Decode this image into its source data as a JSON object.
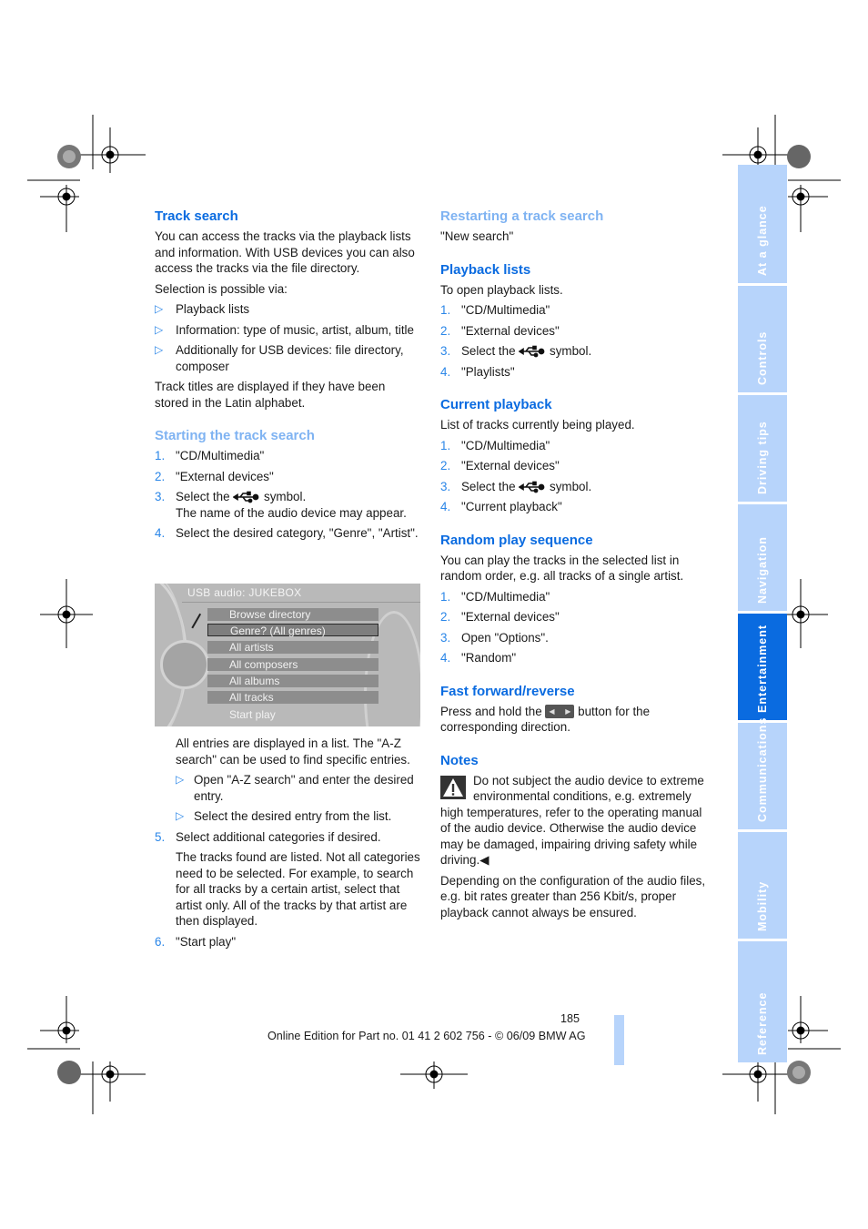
{
  "left": {
    "track_search": {
      "title": "Track search",
      "intro": "You can access the tracks via the playback lists and information. With USB devices you can also access the tracks via the file directory.",
      "selection_label": "Selection is possible via:",
      "bullets": [
        "Playback lists",
        "Information: type of music, artist, album, title",
        "Additionally for USB devices: file directory, composer"
      ],
      "latin_note": "Track titles are displayed if they have been stored in the Latin alphabet."
    },
    "starting": {
      "title": "Starting the track search",
      "steps": [
        {
          "n": "1.",
          "text": "\"CD/Multimedia\""
        },
        {
          "n": "2.",
          "text": "\"External devices\""
        },
        {
          "n": "3.",
          "pre": "Select the",
          "post": "symbol.",
          "note": "The name of the audio device may appear."
        },
        {
          "n": "4.",
          "text": "Select the desired category, \"Genre\", \"Artist\"."
        }
      ],
      "after_screen": "All entries are displayed in a list. The \"A-Z search\" can be used to find specific entries.",
      "sub_bullets": [
        "Open \"A-Z search\" and enter the desired entry.",
        "Select the desired entry from the list."
      ],
      "step5": {
        "n": "5.",
        "text": "Select additional categories if desired.",
        "note": "The tracks found are listed. Not all categories need to be selected. For example, to search for all tracks by a certain artist, select that artist only. All of the tracks by that artist are then displayed."
      },
      "step6": {
        "n": "6.",
        "text": "\"Start play\""
      }
    },
    "screen": {
      "title": "USB audio: JUKEBOX",
      "items": [
        "Browse directory",
        "Genre? (All genres)",
        "All artists",
        "All composers",
        "All albums",
        "All tracks",
        "Start play"
      ],
      "selected_index": 1
    }
  },
  "right": {
    "restarting": {
      "title": "Restarting a track search",
      "text": "\"New search\""
    },
    "playback_lists": {
      "title": "Playback lists",
      "intro": "To open playback lists.",
      "steps": [
        {
          "n": "1.",
          "text": "\"CD/Multimedia\""
        },
        {
          "n": "2.",
          "text": "\"External devices\""
        },
        {
          "n": "3.",
          "pre": "Select the",
          "post": "symbol."
        },
        {
          "n": "4.",
          "text": "\"Playlists\""
        }
      ]
    },
    "current_playback": {
      "title": "Current playback",
      "intro": "List of tracks currently being played.",
      "steps": [
        {
          "n": "1.",
          "text": "\"CD/Multimedia\""
        },
        {
          "n": "2.",
          "text": "\"External devices\""
        },
        {
          "n": "3.",
          "pre": "Select the",
          "post": "symbol."
        },
        {
          "n": "4.",
          "text": "\"Current playback\""
        }
      ]
    },
    "random": {
      "title": "Random play sequence",
      "intro": "You can play the tracks in the selected list in random order, e.g. all tracks of a single artist.",
      "steps": [
        {
          "n": "1.",
          "text": "\"CD/Multimedia\""
        },
        {
          "n": "2.",
          "text": "\"External devices\""
        },
        {
          "n": "3.",
          "text": "Open \"Options\"."
        },
        {
          "n": "4.",
          "text": "\"Random\""
        }
      ]
    },
    "ffrev": {
      "title": "Fast forward/reverse",
      "pre": "Press and hold the",
      "post": "button for the corresponding direction."
    },
    "notes": {
      "title": "Notes",
      "warning": "Do not subject the audio device to extreme environmental conditions, e.g. extremely high temperatures, refer to the operating manual of the audio device. Otherwise the audio device may be damaged, impairing driving safety while driving.",
      "end_mark": "◀",
      "text": "Depending on the configuration of the audio files, e.g. bit rates greater than 256 Kbit/s, proper playback cannot always be ensured."
    }
  },
  "tabs": [
    {
      "label": "At a glance",
      "active": false
    },
    {
      "label": "Controls",
      "active": false
    },
    {
      "label": "Driving tips",
      "active": false
    },
    {
      "label": "Navigation",
      "active": false
    },
    {
      "label": "Entertainment",
      "active": true
    },
    {
      "label": "Communications",
      "active": false
    },
    {
      "label": "Mobility",
      "active": false
    },
    {
      "label": "Reference",
      "active": false
    }
  ],
  "footer": {
    "page": "185",
    "edition": "Online Edition for Part no. 01 41 2 602 756 - © 06/09 BMW AG"
  },
  "icons": {
    "bullet": "▷",
    "usb": "usb-symbol",
    "ff": "fast-forward-reverse-button",
    "warning": "warning-triangle"
  }
}
